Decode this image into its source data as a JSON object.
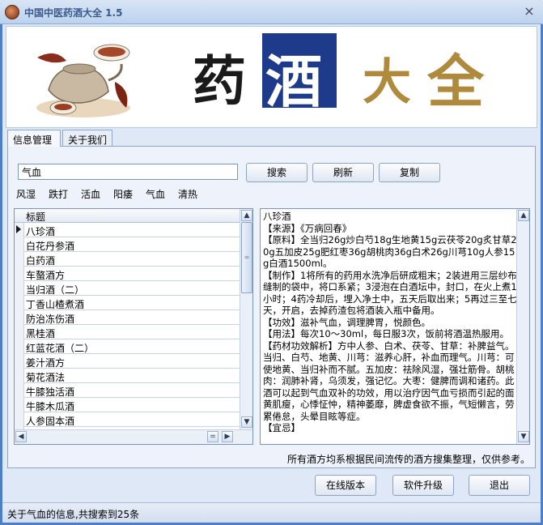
{
  "window": {
    "title": "中国中医药酒大全 1.5",
    "close_glyph": "×"
  },
  "banner": {
    "glyphs": [
      "药",
      "酒",
      "大",
      "全"
    ]
  },
  "tabs": [
    {
      "label": "信息管理",
      "active": true
    },
    {
      "label": "关于我们",
      "active": false
    }
  ],
  "search": {
    "value": "气血",
    "search_label": "搜索",
    "refresh_label": "刷新",
    "copy_label": "复制"
  },
  "categories": [
    "风湿",
    "跌打",
    "活血",
    "阳痿",
    "气血",
    "清热"
  ],
  "list": {
    "header": "标题",
    "selected_index": 0,
    "items": [
      "八珍酒",
      "白花丹参酒",
      "白药酒",
      "车螯酒方",
      "当归酒（二）",
      "丁香山楂煮酒",
      "防治冻伤酒",
      "黑桂酒",
      "红蓝花酒（二）",
      "姜汁酒方",
      "菊花酒法",
      "牛膝独活酒",
      "牛膝木瓜酒",
      "人参固本酒"
    ]
  },
  "scroll": {
    "up": "▲",
    "down": "▼",
    "left": "◀",
    "right": "▶",
    "grip": "="
  },
  "detail": {
    "text": "八珍酒\n【来源】《万病回春》\n【原料】全当归26g炒白芍18g生地黄15g云茯苓20g炙甘草20g五加皮25g肥红枣36g胡桃肉36g白术26g川芎10g人参15g白酒1500ml。\n【制作】1将所有的药用水洗净后研成粗末；2装进用三层纱布缝制的袋中，将口系紧；3浸泡在白酒坛中，封口，在火上煮1小时；4药冷却后，埋入净土中，五天后取出来；5再过三至七天，开启，去掉药渣包将酒装入瓶中备用。\n【功效】滋补气血，调理脾胃，悦颜色。\n【用法】每次10～30ml，每日服3次，饭前将酒温热服用。\n【药材功效解析】方中人参、白术、茯苓、甘草：补脾益气。当归、白芍、地黄、川芎：滋养心肝，补血而理气。川芎：可使地黄、当归补而不腻。五加皮：祛除风湿，强壮筋骨。胡桃肉：润肺补肾，乌须发，强记忆。大枣：健脾而调和诸药。此酒可以起到气血双补的功效，用以治疗因气血亏损而引起的面黄肌瘦，心悸怔忡，精神萎靡，脾虚食欲不振，气短懒言，劳累倦怠，头晕目眩等症。\n【宜忌】"
  },
  "disclaimer": "所有酒方均系根据民间流传的酒方搜集整理，仅供参考。",
  "buttons": {
    "online": "在线版本",
    "upgrade": "软件升级",
    "exit": "退出"
  },
  "status": "关于气血的信息,共搜索到25条"
}
